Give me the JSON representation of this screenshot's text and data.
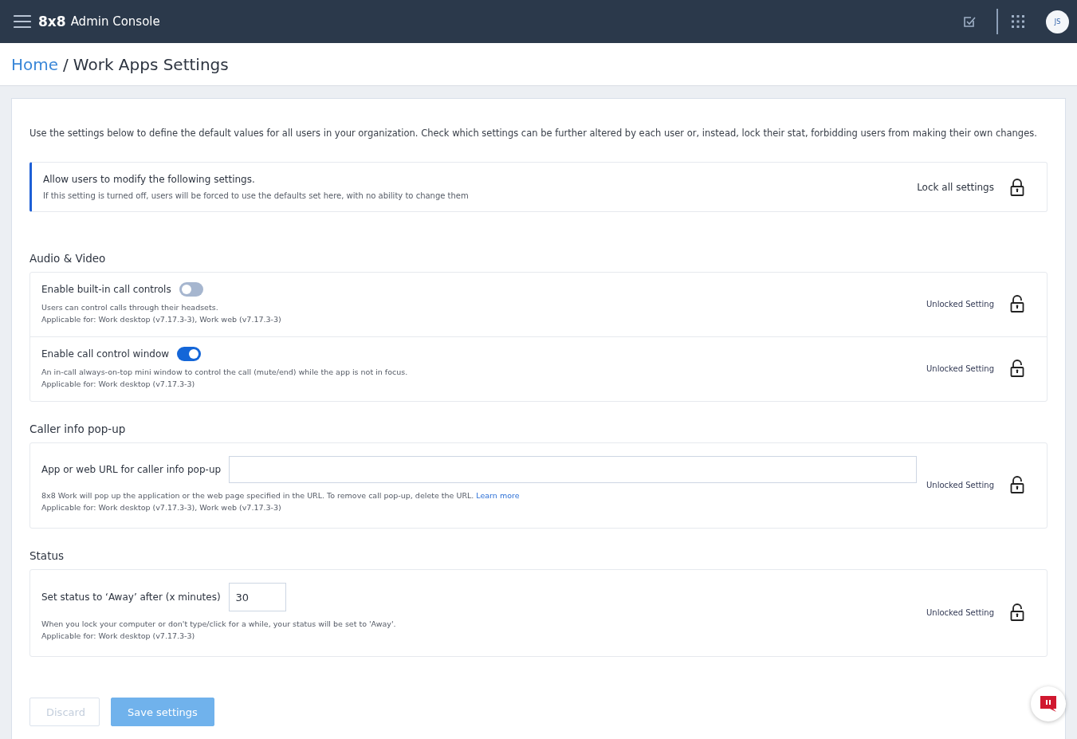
{
  "header": {
    "logo": "8x8",
    "title": "Admin Console",
    "avatar_initials": "JS"
  },
  "breadcrumb": {
    "home": "Home",
    "separator": "/",
    "current": "Work Apps Settings"
  },
  "intro": "Use the settings below to define the default values for all users in your organization. Check which settings can be further altered by each user or, instead, lock their stat, forbidding users from making their own changes.",
  "lock_banner": {
    "title": "Allow users to modify the following settings.",
    "subtitle": "If this setting is turned off, users will be forced to use the defaults set here, with no ability to change them",
    "action": "Lock all settings"
  },
  "sections": [
    {
      "title": "Audio & Video",
      "settings": [
        {
          "kind": "toggle",
          "label": "Enable built-in call controls",
          "on": false,
          "description": "Users can control calls through their headsets.",
          "applicable": "Applicable for: Work desktop (v7.17.3-3), Work web (v7.17.3-3)",
          "lock_label": "Unlocked Setting",
          "locked": false
        },
        {
          "kind": "toggle",
          "label": "Enable call control window",
          "on": true,
          "description": "An in-call always-on-top mini window to control the call (mute/end) while the app is not in focus.",
          "applicable": "Applicable for: Work desktop (v7.17.3-3)",
          "lock_label": "Unlocked Setting",
          "locked": false
        }
      ]
    },
    {
      "title": "Caller info pop-up",
      "settings": [
        {
          "kind": "url",
          "label": "App or web URL for caller info pop-up",
          "description": "8x8 Work will pop up the application or the web page specified in the URL. To remove call pop-up, delete the URL.",
          "link": "Learn more",
          "applicable": "Applicable for: Work desktop (v7.17.3-3), Work web (v7.17.3-3)",
          "lock_label": "Unlocked Setting",
          "locked": false
        }
      ]
    },
    {
      "title": "Status",
      "settings": [
        {
          "kind": "number",
          "label": "Set status to ‘Away’ after (x minutes)",
          "value": "30",
          "description": "When you lock your computer or don't type/click for a while, your status will be set to 'Away'.",
          "applicable": "Applicable for: Work desktop (v7.17.3-3)",
          "lock_label": "Unlocked Setting",
          "locked": false
        }
      ]
    }
  ],
  "buttons": [
    {
      "kind": "secondary",
      "label": "Discard",
      "disabled": true
    },
    {
      "kind": "primary",
      "label": "Save settings",
      "disabled": true
    }
  ]
}
